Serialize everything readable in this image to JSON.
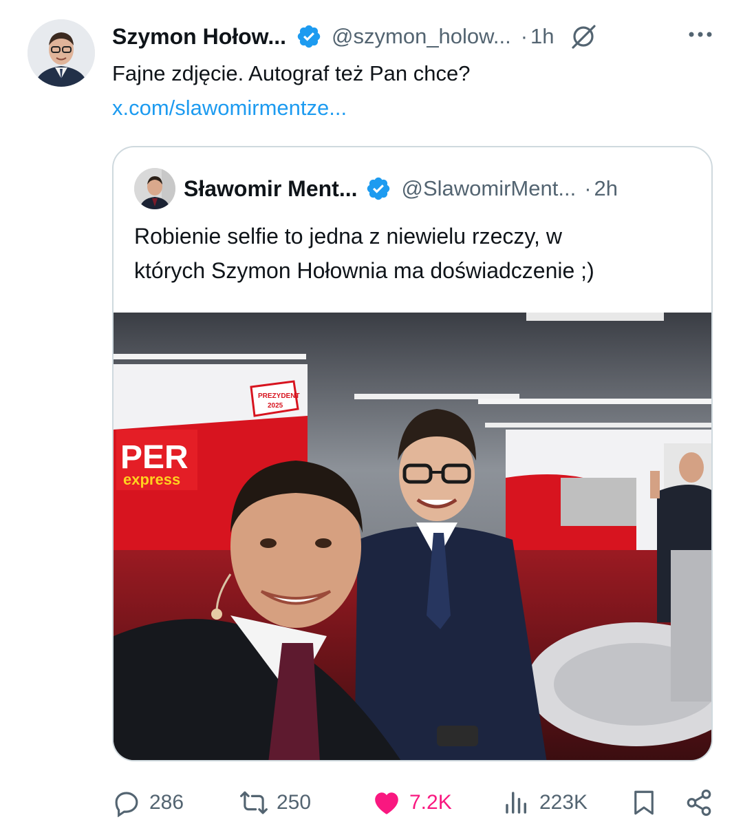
{
  "tweet": {
    "author_name": "Szymon Hołow...",
    "author_handle": "@szymon_holow...",
    "separator": "·",
    "time": "1h",
    "text": "Fajne zdjęcie. Autograf też Pan chce?",
    "link": "x.com/slawomirmentze..."
  },
  "quoted": {
    "author_name": "Sławomir Ment...",
    "author_handle": "@SlawomirMent...",
    "separator": "·",
    "time": "2h",
    "text_line1": "Robienie selfie to jedna z niewielu rzeczy, w",
    "text_line2": "których Szymon Hołownia ma doświadczenie ;)",
    "photo_sign_line1": "PER",
    "photo_sign_line2": "express",
    "photo_badge_line1": "PREZYDENT",
    "photo_badge_line2": "2025"
  },
  "actions": {
    "replies": "286",
    "reposts": "250",
    "likes": "7.2K",
    "views": "223K"
  },
  "colors": {
    "verified": "#1d9bf0",
    "link": "#1d9bf0",
    "like": "#f91880",
    "muted": "#536471",
    "border": "#cfd9de"
  },
  "icons": [
    "verified-badge-icon",
    "grok-icon",
    "more-icon",
    "reply-icon",
    "repost-icon",
    "like-icon",
    "views-icon",
    "bookmark-icon",
    "share-icon"
  ]
}
